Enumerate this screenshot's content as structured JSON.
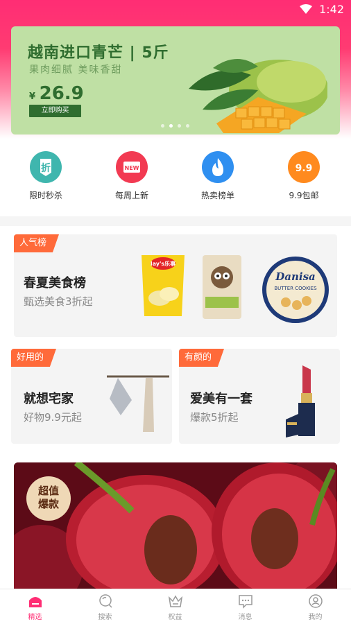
{
  "status_bar": {
    "time": "1:42"
  },
  "banner": {
    "title": "越南进口青芒 | 5斤",
    "subtitle": "果肉细腻  美味香甜",
    "currency": "¥",
    "price": "26.9",
    "buy_label": "立即购买",
    "slide_count": 4,
    "active_slide": 1
  },
  "categories": [
    {
      "label": "限时秒杀",
      "glyph": "折",
      "color": "#3fb6ae",
      "icon": "discount-tag-icon"
    },
    {
      "label": "每周上新",
      "glyph": "NEW",
      "color": "#f23a52",
      "icon": "new-badge-icon"
    },
    {
      "label": "热卖榜单",
      "glyph": "",
      "color": "#2f8ff0",
      "icon": "flame-icon"
    },
    {
      "label": "9.9包邮",
      "glyph": "9.9",
      "color": "#ff8a1e",
      "icon": "price-99-icon"
    }
  ],
  "popular": {
    "tag": "人气榜",
    "title": "春夏美食榜",
    "subtitle": "甄选美食3折起",
    "products": [
      "chips-bag",
      "squirrel-snack-bag",
      "danisa-cookie-tin"
    ],
    "chips_brand": "lay's乐事",
    "tin_brand": "Danisa",
    "tin_sub": "BUTTER COOKIES"
  },
  "home": {
    "tag": "好用的",
    "title": "就想宅家",
    "subtitle": "好物9.9元起"
  },
  "beauty": {
    "tag": "有颜的",
    "title": "爱美有一套",
    "subtitle": "爆款5折起"
  },
  "promo": {
    "badge_line1": "超值",
    "badge_line2": "爆款"
  },
  "nav": [
    {
      "label": "精选",
      "icon": "home-icon",
      "active": true
    },
    {
      "label": "搜索",
      "icon": "search-icon",
      "active": false
    },
    {
      "label": "权益",
      "icon": "crown-icon",
      "active": false
    },
    {
      "label": "消息",
      "icon": "message-icon",
      "active": false
    },
    {
      "label": "我的",
      "icon": "profile-icon",
      "active": false
    }
  ],
  "colors": {
    "brand": "#ff2d74",
    "tag": "#ff6a3a",
    "banner_green": "#bfe0a4"
  }
}
